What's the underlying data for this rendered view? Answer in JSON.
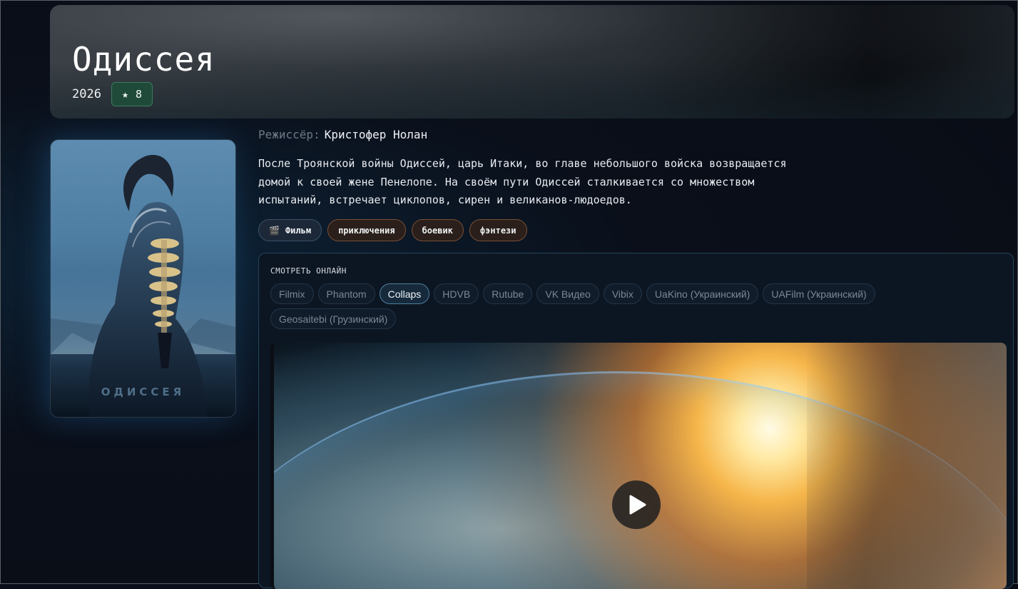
{
  "movie": {
    "title": "Одиссея",
    "year": "2026",
    "rating_icon": "star-icon",
    "rating": "8",
    "poster_title": "ОДИССЕЯ"
  },
  "director": {
    "label": "Режиссёр:",
    "name": "Кристофер Нолан"
  },
  "description": "После Троянской войны Одиссей, царь Итаки, во главе небольшого войска возвращается домой к своей жене Пенелопе. На своём пути Одиссей сталкивается со множеством испытаний, встречает циклопов, сирен и великанов-людоедов.",
  "tags": {
    "type": {
      "icon": "clapperboard-icon",
      "label": "Фильм"
    },
    "genres": [
      "приключения",
      "боевик",
      "фэнтези"
    ]
  },
  "watch": {
    "heading": "СМОТРЕТЬ ОНЛАЙН",
    "sources": [
      "Filmix",
      "Phantom",
      "Collaps",
      "HDVB",
      "Rutube",
      "VK Видео",
      "Vibix",
      "UaKino (Украинский)",
      "UAFilm (Украинский)",
      "Geosaitebi (Грузинский)"
    ],
    "active_source": "Collaps",
    "player": {
      "play_icon": "play-icon"
    }
  },
  "colors": {
    "background": "#0a0f1a",
    "rating_badge": "#1f4a3a",
    "genre_border": "#7a4f36",
    "panel_border": "#24435a"
  }
}
